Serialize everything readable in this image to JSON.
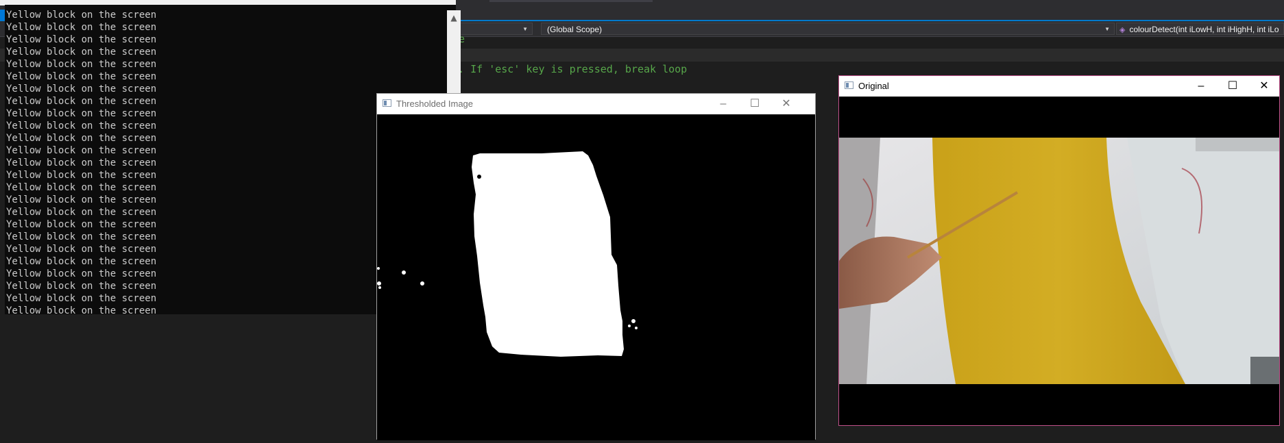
{
  "ide": {
    "code_top": "ze",
    "code_line": "ms. If 'esc' key is pressed, break loop",
    "nav_left": "",
    "nav_scope": "(Global Scope)",
    "nav_function": "colourDetect(int iLowH, int iHighH, int iLo"
  },
  "console": {
    "lines": [
      "Yellow block on the screen",
      "Yellow block on the screen",
      "Yellow block on the screen",
      "Yellow block on the screen",
      "Yellow block on the screen",
      "Yellow block on the screen",
      "Yellow block on the screen",
      "Yellow block on the screen",
      "Yellow block on the screen",
      "Yellow block on the screen",
      "Yellow block on the screen",
      "Yellow block on the screen",
      "Yellow block on the screen",
      "Yellow block on the screen",
      "Yellow block on the screen",
      "Yellow block on the screen",
      "Yellow block on the screen",
      "Yellow block on the screen",
      "Yellow block on the screen",
      "Yellow block on the screen",
      "Yellow block on the screen",
      "Yellow block on the screen",
      "Yellow block on the screen",
      "Yellow block on the screen",
      "Yellow block on the screen"
    ]
  },
  "thresholded_window": {
    "title": "Thresholded Image",
    "minimize_icon": "minimize-icon",
    "maximize_icon": "maximize-icon",
    "close_icon": "close-icon"
  },
  "original_window": {
    "title": "Original",
    "minimize_icon": "minimize-icon",
    "maximize_icon": "maximize-icon",
    "close_icon": "close-icon"
  },
  "colors": {
    "ide_background": "#1e1e1e",
    "ide_accent": "#007acc",
    "code_comment": "#57a64a",
    "console_background": "#0c0c0c",
    "console_text": "#cccccc",
    "yellow_paper": "#d2aa1c",
    "original_border": "#c0508a"
  }
}
